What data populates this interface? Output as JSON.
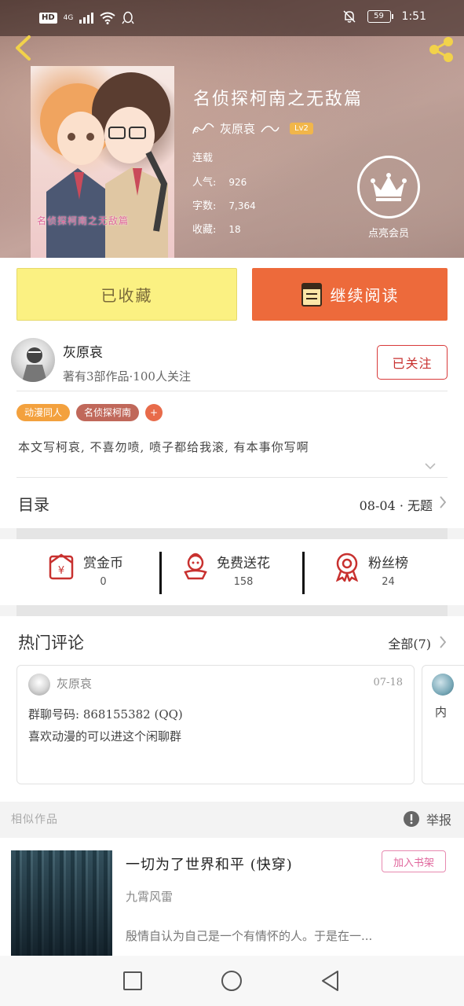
{
  "status_bar": {
    "hd": "HD",
    "network": "4G",
    "battery": "59",
    "time": "1:51"
  },
  "book": {
    "title": "名侦探柯南之无敌篇",
    "author": "灰原哀",
    "level": "Lv2",
    "cover_text": "名侦探柯南之无敌篇",
    "status": "连载",
    "popularity_label": "人气:",
    "popularity": "926",
    "words_label": "字数:",
    "words": "7,364",
    "favorites_label": "收藏:",
    "favorites": "18"
  },
  "vip": {
    "label": "点亮会员"
  },
  "actions": {
    "collected_label": "已收藏",
    "read_label": "继续阅读"
  },
  "author_card": {
    "name": "灰原哀",
    "description": "著有3部作品·100人关注",
    "follow_label": "已关注"
  },
  "tags": [
    "动漫同人",
    "名侦探柯南",
    "+"
  ],
  "intro": "本文写柯哀, 不喜勿喷, 喷子都给我滚, 有本事你写啊",
  "catalog": {
    "label": "目录",
    "latest": "08-04 · 无题"
  },
  "stats": [
    {
      "title": "赏金币",
      "value": "0",
      "icon": "gold-coin-icon"
    },
    {
      "title": "免费送花",
      "value": "158",
      "icon": "flower-icon"
    },
    {
      "title": "粉丝榜",
      "value": "24",
      "icon": "medal-icon"
    }
  ],
  "comments": {
    "title": "热门评论",
    "all_label": "全部(7)",
    "items": [
      {
        "user": "灰原哀",
        "date": "07-18",
        "line1": "群聊号码: 868155382 (QQ)",
        "line2": "喜欢动漫的可以进这个闲聊群"
      },
      {
        "text": "内"
      }
    ]
  },
  "similar": {
    "label": "相似作品",
    "report_label": "举报",
    "item": {
      "title": "一切为了世界和平 (快穿)",
      "author": "九霄风雷",
      "description": "殷情自认为自己是一个有情怀的人。于是在一...",
      "add_label": "加入书架"
    }
  },
  "colors": {
    "accent_orange": "#ed6a3b",
    "collected_yellow": "#fbf182",
    "follow_red": "#c8312f",
    "tag_orange": "#f3a13e",
    "tag_brown": "#c0685a"
  }
}
